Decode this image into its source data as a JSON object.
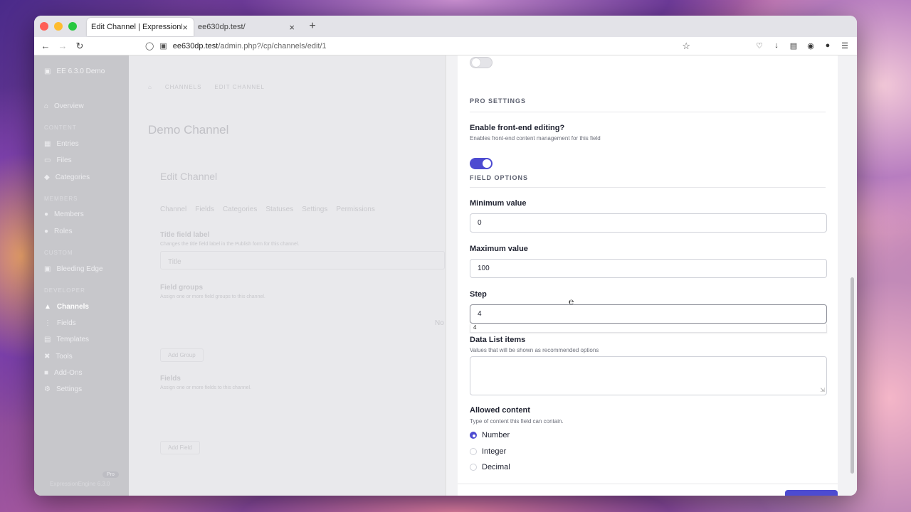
{
  "browser": {
    "tabs": [
      {
        "title": "Edit Channel | ExpressionEngine",
        "close": "×",
        "active": true
      },
      {
        "title": "ee630dp.test/",
        "close": "×",
        "active": false
      }
    ],
    "new_tab": "+",
    "url_host": "ee630dp.test",
    "url_path": "/admin.php?/cp/channels/edit/1"
  },
  "sidebar": {
    "brand": "EE 6.3.0 Demo",
    "items": [
      {
        "label": "Overview"
      },
      {
        "section": "CONTENT"
      },
      {
        "label": "Entries"
      },
      {
        "label": "Files"
      },
      {
        "label": "Categories"
      },
      {
        "section": "MEMBERS"
      },
      {
        "label": "Members"
      },
      {
        "label": "Roles"
      },
      {
        "section": "CUSTOM"
      },
      {
        "label": "Bleeding Edge"
      },
      {
        "section": "DEVELOPER"
      },
      {
        "label": "Channels"
      },
      {
        "label": "Fields"
      },
      {
        "label": "Templates"
      },
      {
        "label": "Tools"
      },
      {
        "label": "Add-Ons"
      },
      {
        "label": "Settings"
      }
    ],
    "footer": "ExpressionEngine 6.3.0",
    "pill": "Pro"
  },
  "background_page": {
    "breadcrumb": [
      "CHANNELS",
      "EDIT CHANNEL"
    ],
    "title": "Demo Channel",
    "card_title": "Edit Channel",
    "tabs": [
      "Channel",
      "Fields",
      "Categories",
      "Statuses",
      "Settings",
      "Permissions"
    ],
    "title_field_label": "Title field label",
    "title_field_desc": "Changes the title field label in the Publish form for this channel.",
    "title_field_value": "Title",
    "field_groups_label": "Field groups",
    "field_groups_desc": "Assign one or more field groups to this channel.",
    "no_text": "No",
    "add_group": "Add Group",
    "fields_label": "Fields",
    "fields_desc": "Assign one or more fields to this channel.",
    "add_field": "Add Field"
  },
  "panel": {
    "pro_settings_title": "PRO SETTINGS",
    "frontend_label": "Enable front-end editing?",
    "frontend_desc": "Enables front-end content management for this field",
    "field_options_title": "FIELD OPTIONS",
    "min_label": "Minimum value",
    "min_value": "0",
    "max_label": "Maximum value",
    "max_value": "100",
    "step_label": "Step",
    "step_value": "4",
    "step_suggestion": "4",
    "datalist_label": "Data List items",
    "datalist_desc": "Values that will be shown as recommended options",
    "allowed_label": "Allowed content",
    "allowed_desc": "Type of content this field can contain.",
    "allowed_options": [
      {
        "label": "Number",
        "checked": true
      },
      {
        "label": "Integer",
        "checked": false
      },
      {
        "label": "Decimal",
        "checked": false
      }
    ]
  },
  "colors": {
    "accent": "#4d4bd1"
  }
}
